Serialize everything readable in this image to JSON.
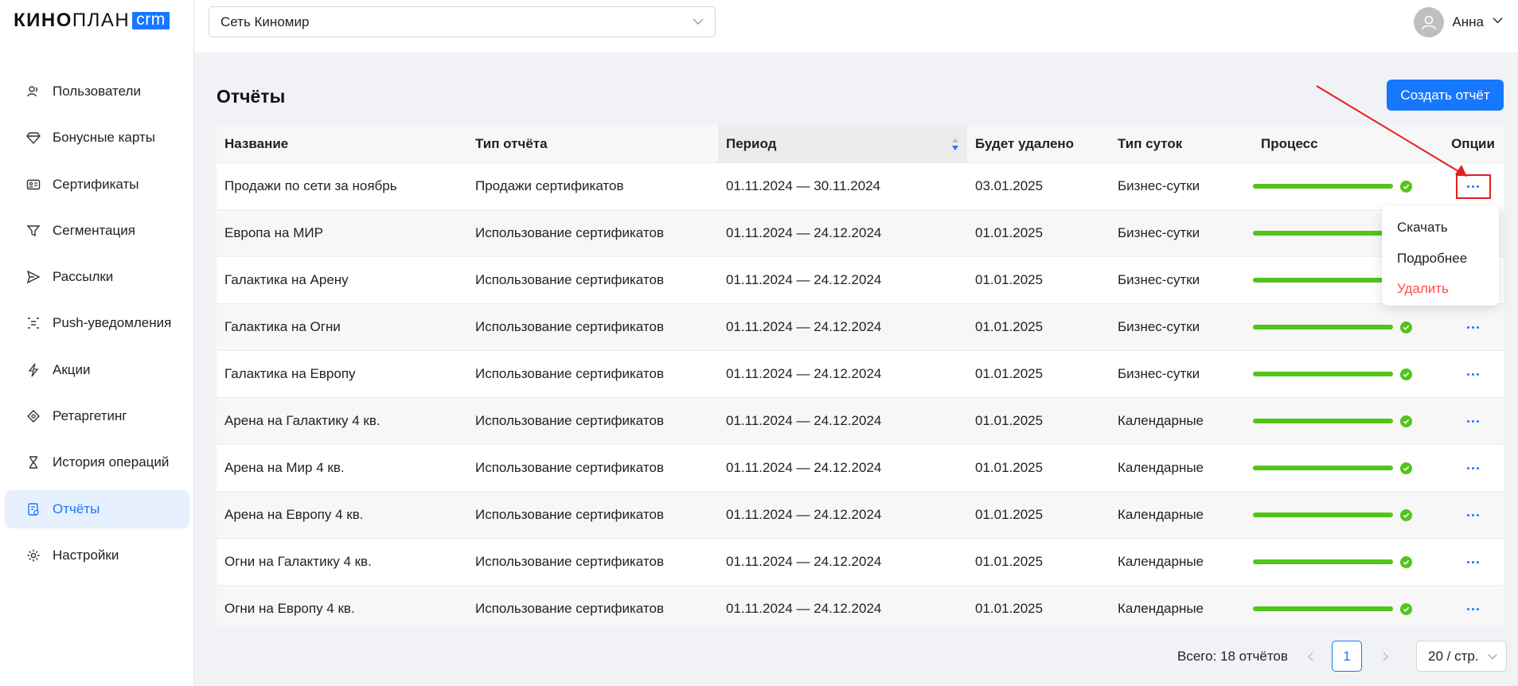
{
  "brand": {
    "name_bold": "КИНО",
    "name_light": "ПЛАН",
    "badge": "crm",
    "accent": "#1677ff"
  },
  "sidebar": {
    "items": [
      {
        "label": "Пользователи",
        "icon": "users-icon",
        "active": false
      },
      {
        "label": "Бонусные карты",
        "icon": "diamond-icon",
        "active": false
      },
      {
        "label": "Сертификаты",
        "icon": "id-card-icon",
        "active": false
      },
      {
        "label": "Сегментация",
        "icon": "filter-icon",
        "active": false
      },
      {
        "label": "Рассылки",
        "icon": "send-icon",
        "active": false
      },
      {
        "label": "Push-уведомления",
        "icon": "push-icon",
        "active": false
      },
      {
        "label": "Акции",
        "icon": "lightning-icon",
        "active": false
      },
      {
        "label": "Ретаргетинг",
        "icon": "target-icon",
        "active": false
      },
      {
        "label": "История операций",
        "icon": "hourglass-icon",
        "active": false
      },
      {
        "label": "Отчёты",
        "icon": "report-icon",
        "active": true
      },
      {
        "label": "Настройки",
        "icon": "gear-icon",
        "active": false
      }
    ]
  },
  "header": {
    "network": "Сеть Киномир",
    "user_name": "Анна"
  },
  "main": {
    "title": "Отчёты",
    "create_button": "Создать отчёт",
    "table": {
      "columns": [
        "Название",
        "Тип отчёта",
        "Период",
        "Будет удалено",
        "Тип суток",
        "Процесс",
        "Опции"
      ],
      "rows": [
        {
          "name": "Продажи по сети за ноябрь",
          "type": "Продажи сертификатов",
          "period": "01.11.2024 — 30.11.2024",
          "delete_on": "03.01.2025",
          "day_type": "Бизнес-сутки",
          "progress": 1.0
        },
        {
          "name": "Европа на МИР",
          "type": "Использование сертификатов",
          "period": "01.11.2024 — 24.12.2024",
          "delete_on": "01.01.2025",
          "day_type": "Бизнес-сутки",
          "progress": 1.0
        },
        {
          "name": "Галактика на Арену",
          "type": "Использование сертификатов",
          "period": "01.11.2024 — 24.12.2024",
          "delete_on": "01.01.2025",
          "day_type": "Бизнес-сутки",
          "progress": 1.0
        },
        {
          "name": "Галактика на Огни",
          "type": "Использование сертификатов",
          "period": "01.11.2024 — 24.12.2024",
          "delete_on": "01.01.2025",
          "day_type": "Бизнес-сутки",
          "progress": 1.0
        },
        {
          "name": "Галактика на Европу",
          "type": "Использование сертификатов",
          "period": "01.11.2024 — 24.12.2024",
          "delete_on": "01.01.2025",
          "day_type": "Бизнес-сутки",
          "progress": 1.0
        },
        {
          "name": "Арена на Галактику 4 кв.",
          "type": "Использование сертификатов",
          "period": "01.11.2024 — 24.12.2024",
          "delete_on": "01.01.2025",
          "day_type": "Календарные",
          "progress": 1.0
        },
        {
          "name": "Арена на Мир 4 кв.",
          "type": "Использование сертификатов",
          "period": "01.11.2024 — 24.12.2024",
          "delete_on": "01.01.2025",
          "day_type": "Календарные",
          "progress": 1.0
        },
        {
          "name": "Арена на Европу 4 кв.",
          "type": "Использование сертификатов",
          "period": "01.11.2024 — 24.12.2024",
          "delete_on": "01.01.2025",
          "day_type": "Календарные",
          "progress": 1.0
        },
        {
          "name": "Огни на Галактику 4 кв.",
          "type": "Использование сертификатов",
          "period": "01.11.2024 — 24.12.2024",
          "delete_on": "01.01.2025",
          "day_type": "Календарные",
          "progress": 1.0
        },
        {
          "name": "Огни на Европу 4 кв.",
          "type": "Использование сертификатов",
          "period": "01.11.2024 — 24.12.2024",
          "delete_on": "01.01.2025",
          "day_type": "Календарные",
          "progress": 1.0
        }
      ]
    },
    "options_menu": {
      "items": [
        {
          "label": "Скачать",
          "danger": false
        },
        {
          "label": "Подробнее",
          "danger": false
        },
        {
          "label": "Удалить",
          "danger": true
        }
      ]
    },
    "pagination": {
      "total": "Всего: 18 отчётов",
      "current_page": "1",
      "page_size": "20 / стр."
    }
  },
  "colors": {
    "primary": "#1677ff",
    "success": "#52c41a",
    "danger": "#ff4d4f",
    "annotation": "#e02020"
  }
}
